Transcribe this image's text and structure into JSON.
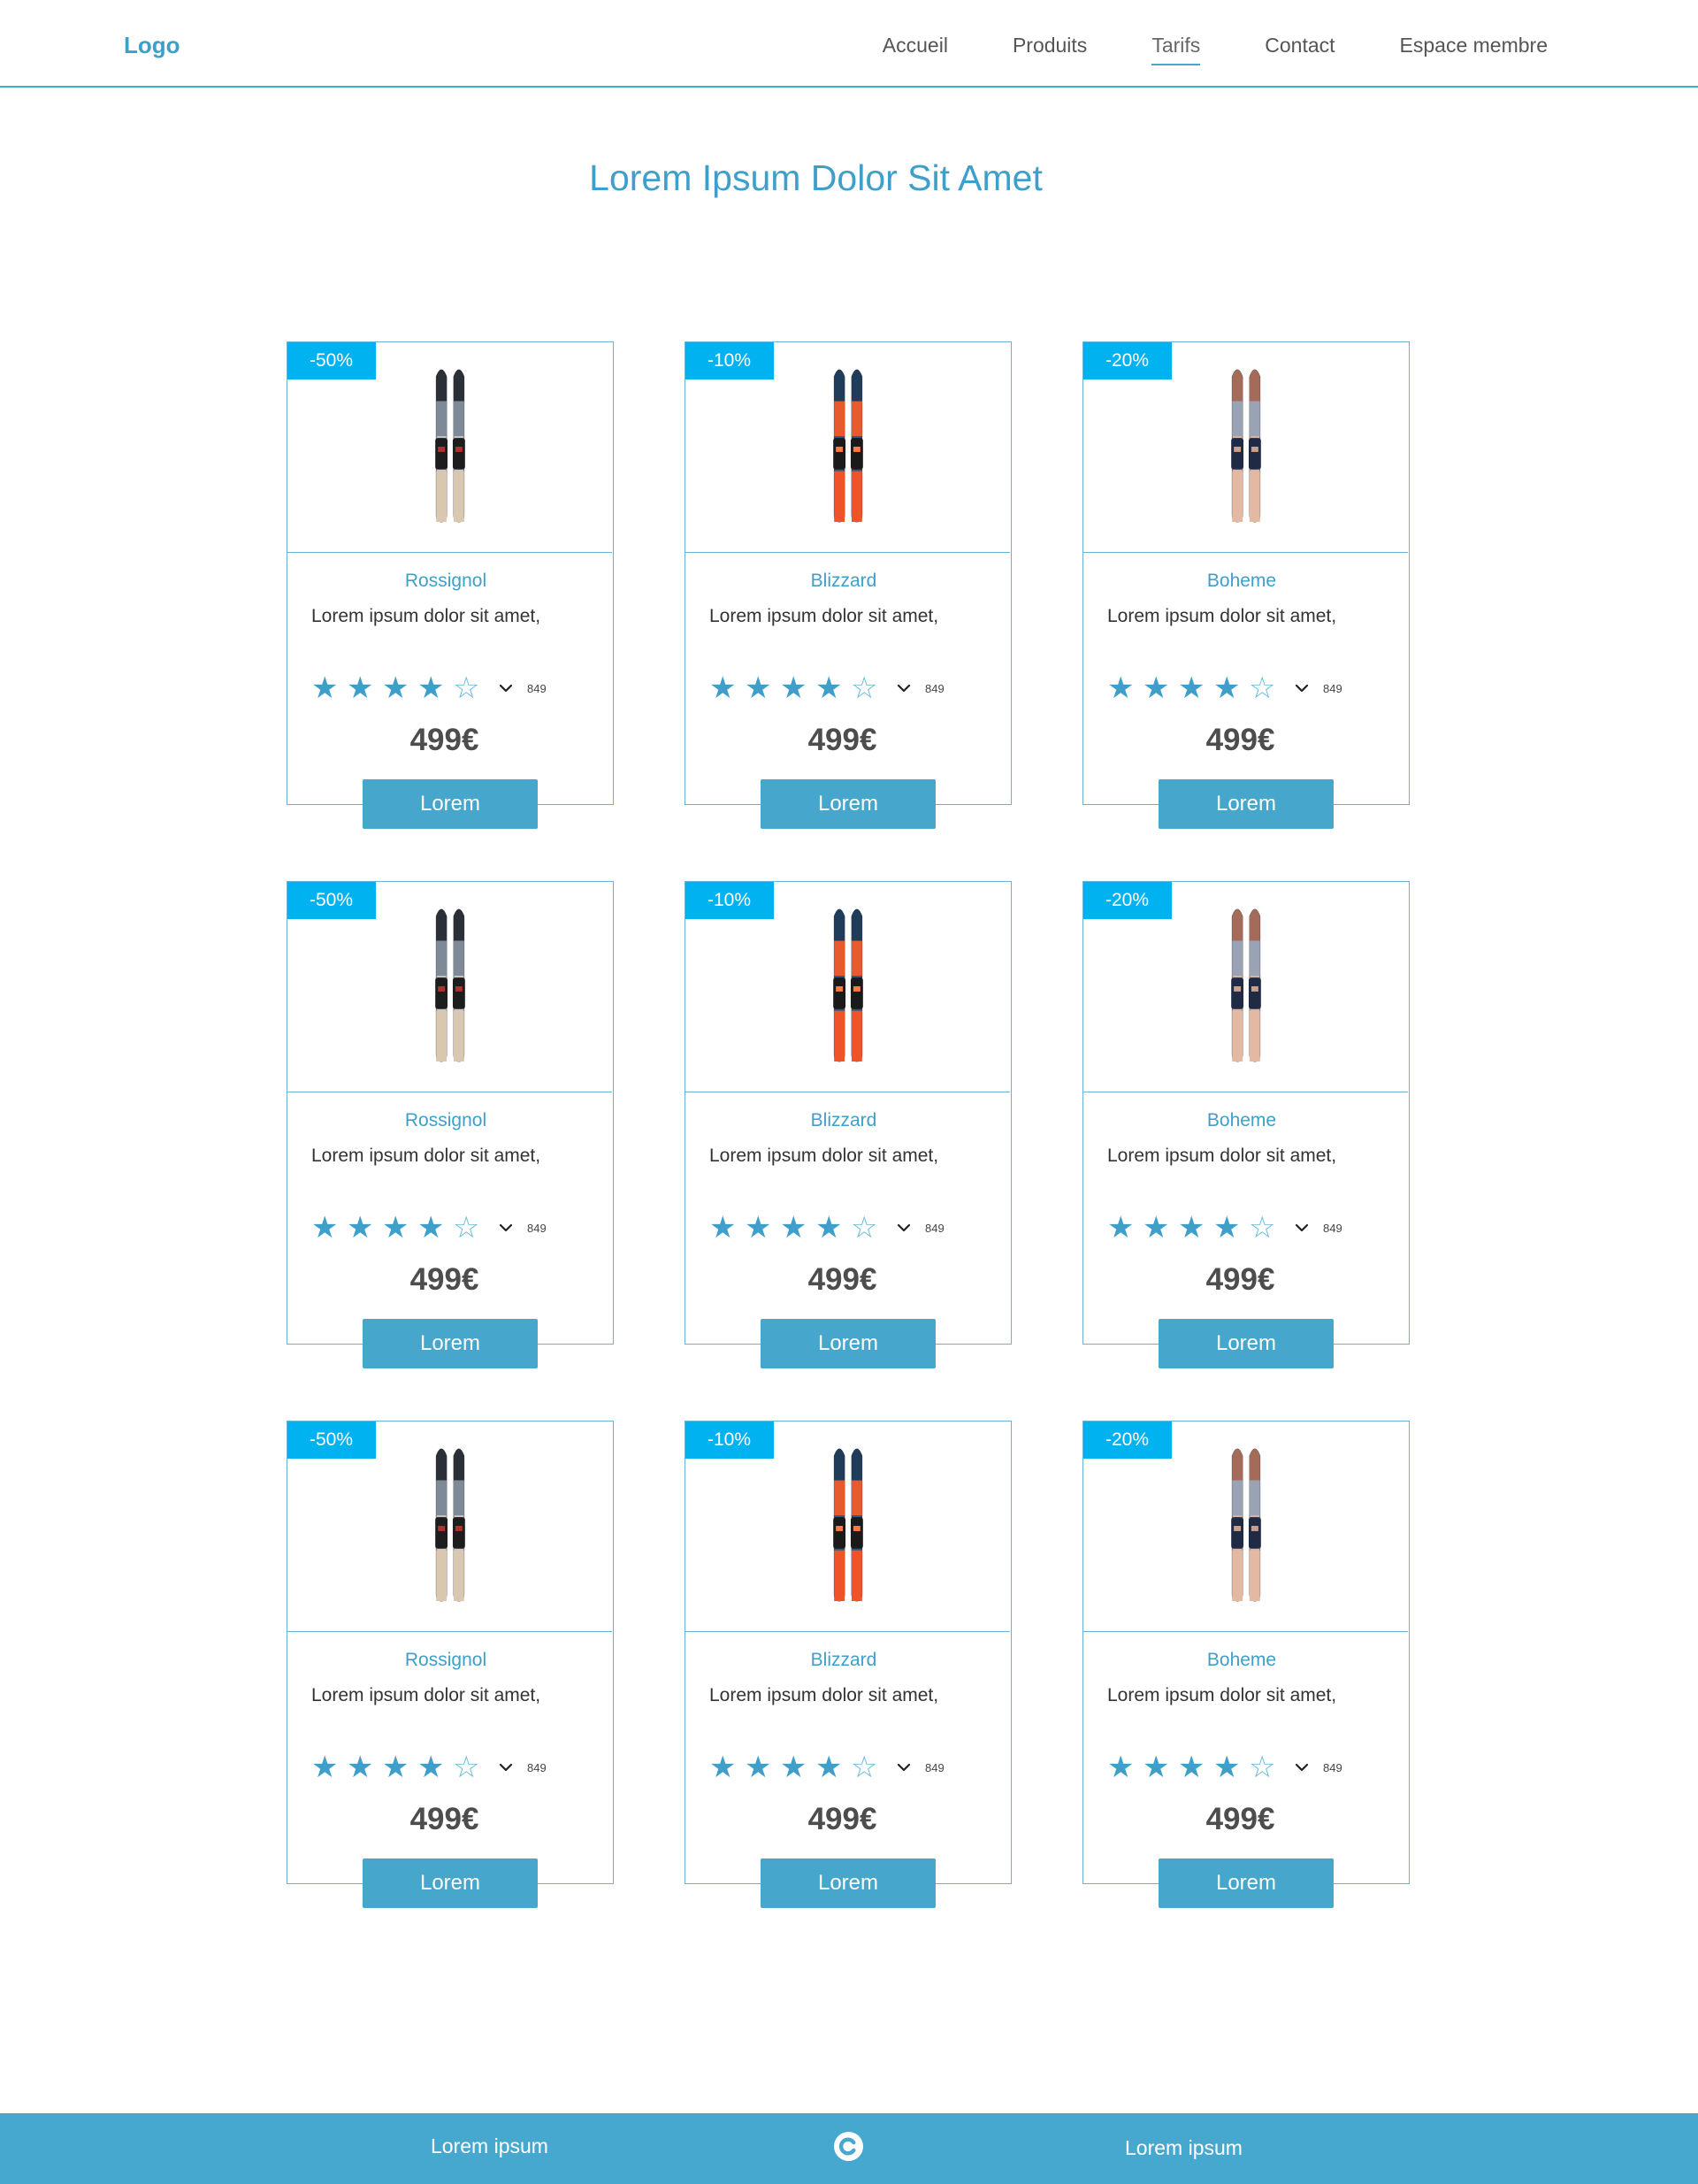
{
  "header": {
    "logo": "Logo",
    "nav": [
      {
        "label": "Accueil"
      },
      {
        "label": "Produits"
      },
      {
        "label": "Tarifs",
        "active": true
      },
      {
        "label": "Contact"
      },
      {
        "label": "Espace membre"
      }
    ]
  },
  "page_title": "Lorem Ipsum Dolor Sit Amet",
  "products": [
    {
      "badge": "-50%",
      "brand": "Rossignol",
      "description": "Lorem ipsum dolor sit amet,",
      "rating": 4,
      "rating_max": 5,
      "review_count": "849",
      "price": "499€",
      "cta": "Lorem",
      "ski": "rossignol"
    },
    {
      "badge": "-10%",
      "brand": "Blizzard",
      "description": "Lorem ipsum dolor sit amet,",
      "rating": 4,
      "rating_max": 5,
      "review_count": "849",
      "price": "499€",
      "cta": "Lorem",
      "ski": "blizzard"
    },
    {
      "badge": "-20%",
      "brand": "Boheme",
      "description": "Lorem ipsum dolor sit amet,",
      "rating": 4,
      "rating_max": 5,
      "review_count": "849",
      "price": "499€",
      "cta": "Lorem",
      "ski": "boheme"
    },
    {
      "badge": "-50%",
      "brand": "Rossignol",
      "description": "Lorem ipsum dolor sit amet,",
      "rating": 4,
      "rating_max": 5,
      "review_count": "849",
      "price": "499€",
      "cta": "Lorem",
      "ski": "rossignol"
    },
    {
      "badge": "-10%",
      "brand": "Blizzard",
      "description": "Lorem ipsum dolor sit amet,",
      "rating": 4,
      "rating_max": 5,
      "review_count": "849",
      "price": "499€",
      "cta": "Lorem",
      "ski": "blizzard"
    },
    {
      "badge": "-20%",
      "brand": "Boheme",
      "description": "Lorem ipsum dolor sit amet,",
      "rating": 4,
      "rating_max": 5,
      "review_count": "849",
      "price": "499€",
      "cta": "Lorem",
      "ski": "boheme"
    },
    {
      "badge": "-50%",
      "brand": "Rossignol",
      "description": "Lorem ipsum dolor sit amet,",
      "rating": 4,
      "rating_max": 5,
      "review_count": "849",
      "price": "499€",
      "cta": "Lorem",
      "ski": "rossignol"
    },
    {
      "badge": "-10%",
      "brand": "Blizzard",
      "description": "Lorem ipsum dolor sit amet,",
      "rating": 4,
      "rating_max": 5,
      "review_count": "849",
      "price": "499€",
      "cta": "Lorem",
      "ski": "blizzard"
    },
    {
      "badge": "-20%",
      "brand": "Boheme",
      "description": "Lorem ipsum dolor sit amet,",
      "rating": 4,
      "rating_max": 5,
      "review_count": "849",
      "price": "499€",
      "cta": "Lorem",
      "ski": "boheme"
    }
  ],
  "footer": {
    "left": "Lorem ipsum",
    "right": "Lorem ipsum",
    "copyright_icon": "copyright-icon"
  },
  "colors": {
    "accent": "#47a8cf",
    "badge": "#00b2f0",
    "price": "#4d4d4d"
  }
}
